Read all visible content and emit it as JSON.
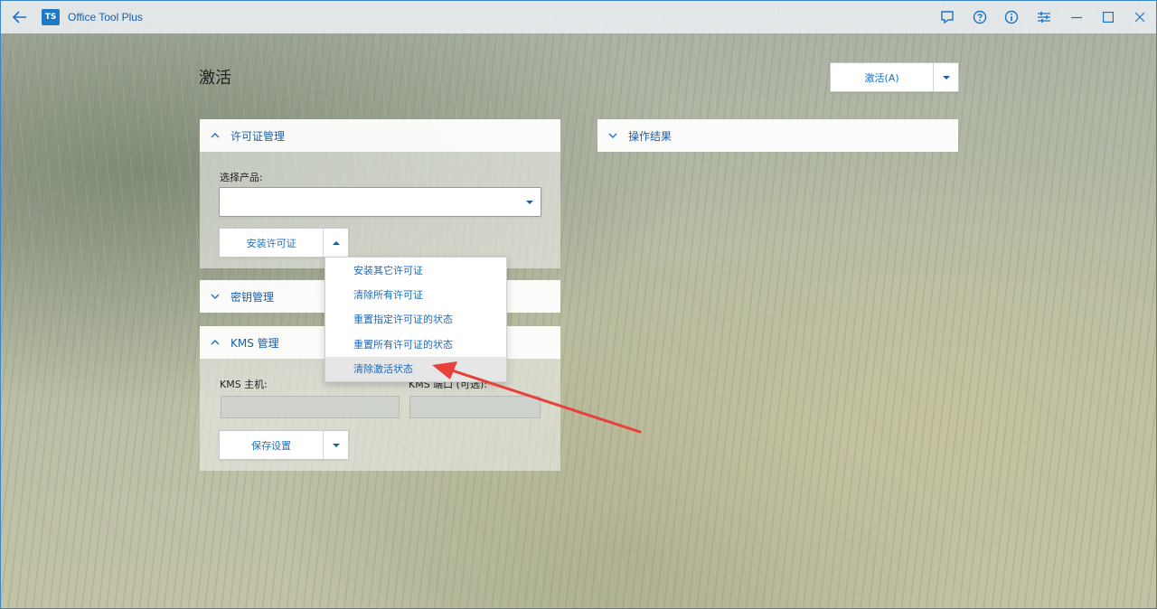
{
  "app": {
    "title": "Office Tool Plus",
    "logo_text": "TS"
  },
  "window_controls": [
    "feedback-icon",
    "help-icon",
    "info-icon",
    "settings-icon",
    "minimize-icon",
    "maximize-icon",
    "close-icon"
  ],
  "page": {
    "title": "激活"
  },
  "activate_button": {
    "label": "激活(A)"
  },
  "sections": {
    "license": {
      "title": "许可证管理",
      "product_label": "选择产品:",
      "product_value": "",
      "install_button": "安装许可证"
    },
    "key": {
      "title": "密钥管理"
    },
    "kms": {
      "title": "KMS 管理",
      "host_label": "KMS 主机:",
      "port_label": "KMS 端口 (可选):",
      "host_value": "",
      "port_value": "",
      "save_button": "保存设置"
    },
    "result": {
      "title": "操作结果"
    }
  },
  "license_menu": {
    "items": [
      "安装其它许可证",
      "清除所有许可证",
      "重置指定许可证的状态",
      "重置所有许可证的状态",
      "清除激活状态"
    ],
    "highlighted_index": 4
  },
  "colors": {
    "accent": "#1a73c7",
    "annotation_arrow": "#e8413a"
  }
}
